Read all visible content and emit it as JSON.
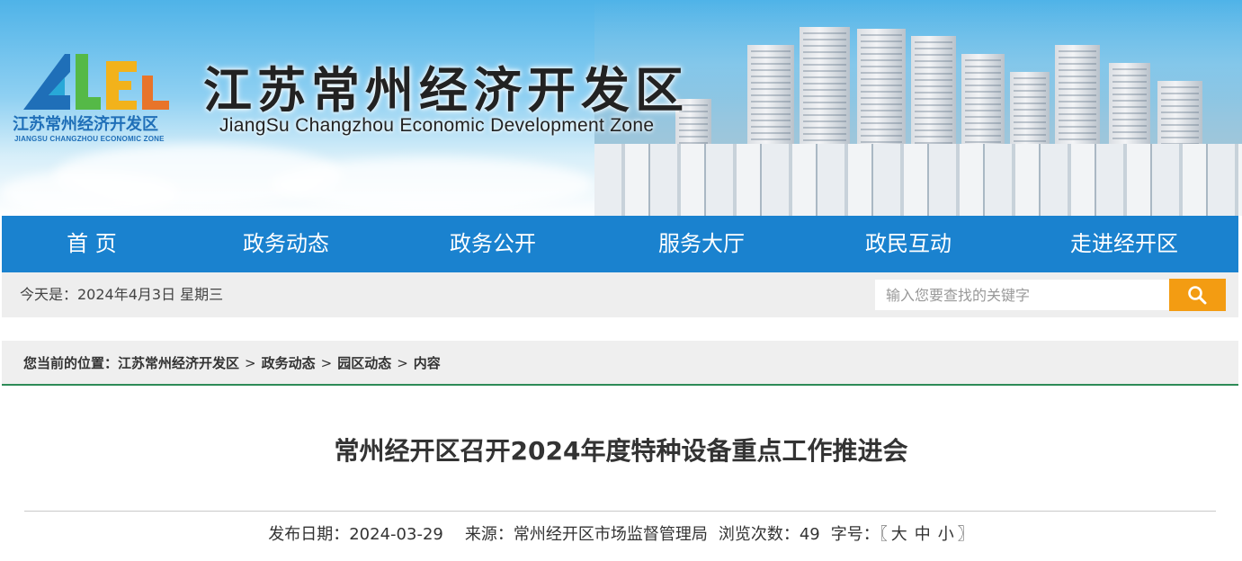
{
  "header": {
    "title": "江苏常州经济开发区",
    "subtitle": "JiangSu Changzhou Economic Development Zone",
    "logo_cn": "江苏常州经济开发区",
    "logo_en": "JIANGSU CHANGZHOU ECONOMIC ZONE"
  },
  "nav": {
    "items": [
      {
        "label": "首 页"
      },
      {
        "label": "政务动态"
      },
      {
        "label": "政务公开"
      },
      {
        "label": "服务大厅"
      },
      {
        "label": "政民互动"
      },
      {
        "label": "走进经开区"
      }
    ]
  },
  "infobar": {
    "today": "今天是：2024年4月3日 星期三",
    "search_placeholder": "输入您要查找的关键字"
  },
  "breadcrumb": {
    "prefix": "您当前的位置：",
    "items": [
      "江苏常州经济开发区",
      "政务动态",
      "园区动态",
      "内容"
    ],
    "separator": ">"
  },
  "article": {
    "title": "常州经开区召开2024年度特种设备重点工作推进会",
    "publish_label": "发布日期：",
    "publish_date": "2024-03-29",
    "source_label": "来源：",
    "source": "常州经开区市场监督管理局",
    "views_label": "浏览次数：",
    "views": "49",
    "fontsize_label": "字号：",
    "fontsize_open": "〖",
    "fontsize_large": "大",
    "fontsize_medium": "中",
    "fontsize_small": "小",
    "fontsize_close": "〗"
  },
  "colors": {
    "nav_bg": "#1a82cf",
    "search_button": "#f39c12",
    "breadcrumb_border": "#2e8b57",
    "logo_blue": "#1f6fb8"
  },
  "icons": {
    "search": "search-icon",
    "logo": "ce-logo-icon"
  }
}
